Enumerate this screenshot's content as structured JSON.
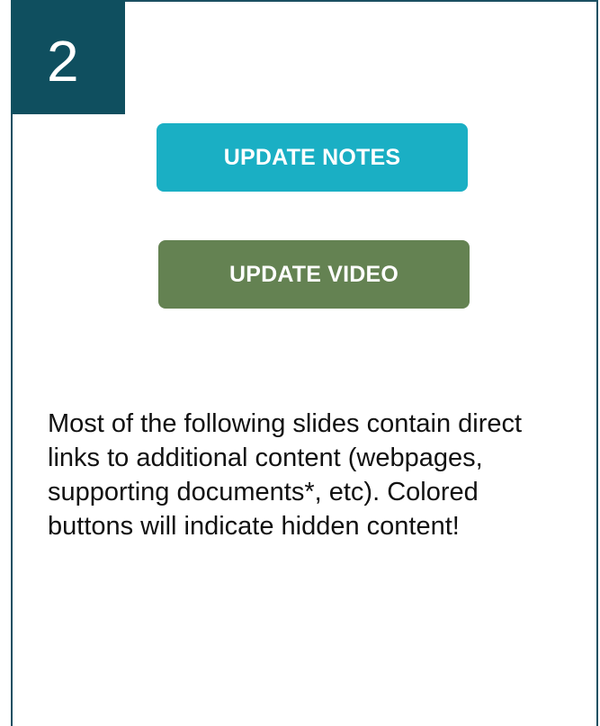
{
  "slide": {
    "number": "2",
    "buttons": {
      "update_notes": "UPDATE NOTES",
      "update_video": "UPDATE VIDEO"
    },
    "body_text": "Most of the following slides contain direct links to additional content (webpages, supporting documents*, etc). Colored buttons will indicate hidden content!"
  },
  "colors": {
    "frame_border": "#1b5062",
    "badge_background": "#0f4f5f",
    "notes_button": "#1aafc4",
    "video_button": "#648252"
  }
}
